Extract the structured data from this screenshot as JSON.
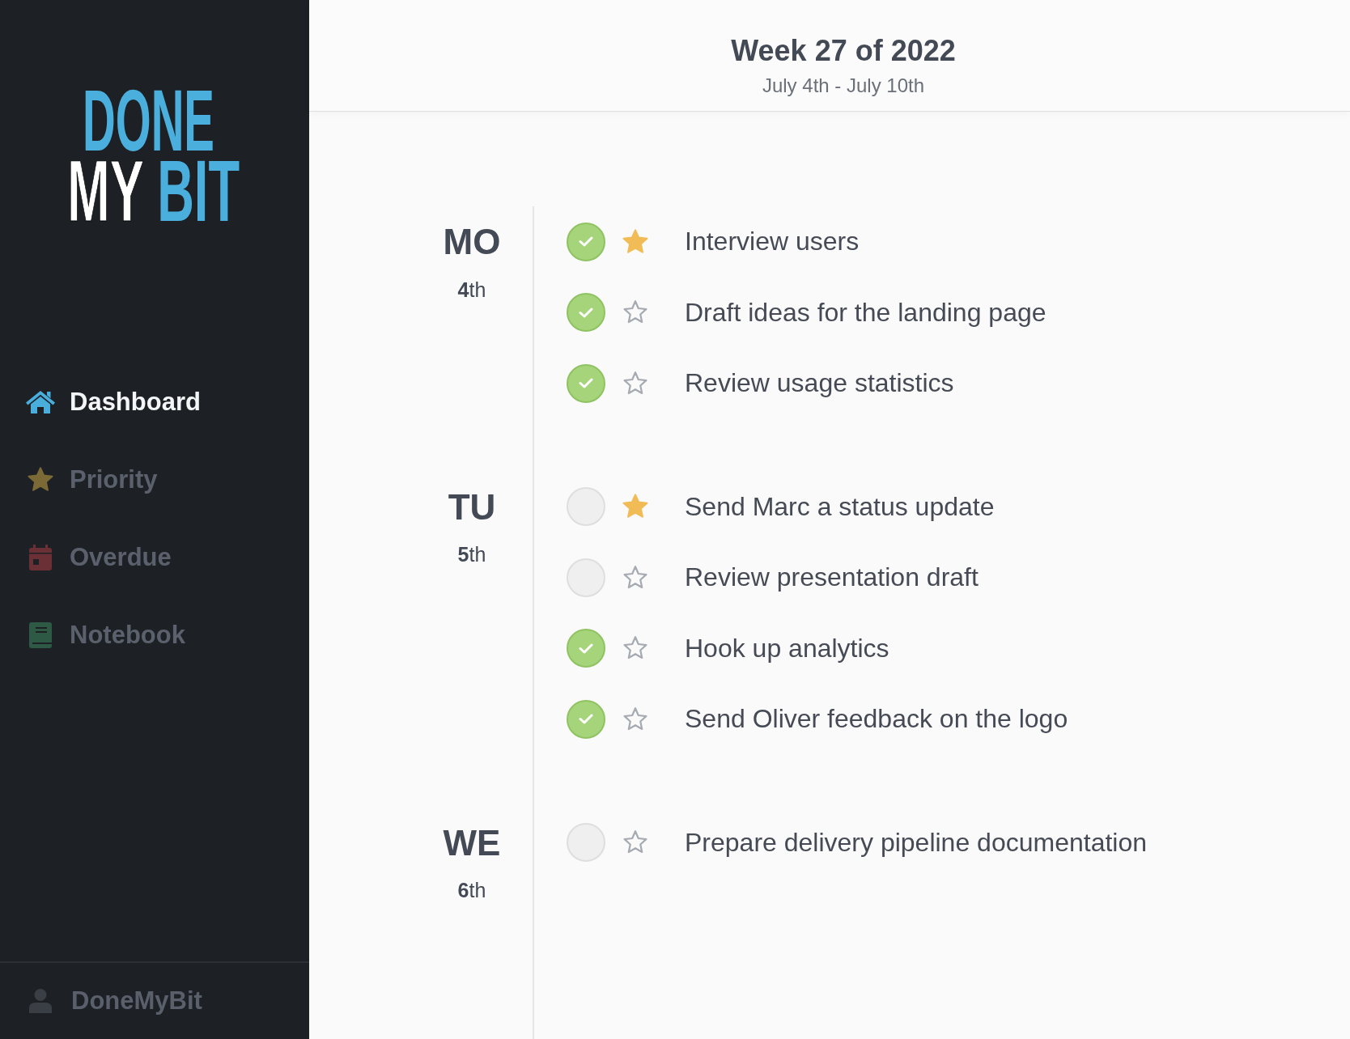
{
  "sidebar": {
    "logo": {
      "top": "DONE",
      "bottom_left": "MY",
      "bottom_right": "BIT"
    },
    "nav": [
      {
        "label": "Dashboard",
        "kind": "home",
        "color": "#4aaedc",
        "selected": true
      },
      {
        "label": "Priority",
        "kind": "star",
        "color": "#7b6a36",
        "selected": false
      },
      {
        "label": "Overdue",
        "kind": "calendar",
        "color": "#6b3035",
        "selected": false
      },
      {
        "label": "Notebook",
        "kind": "book",
        "color": "#2e5a45",
        "selected": false
      }
    ],
    "account": {
      "name": "DoneMyBit"
    }
  },
  "header": {
    "title": "Week 27 of 2022",
    "subtitle": "July 4th - July 10th"
  },
  "days": [
    {
      "name": "MO",
      "date": "**4**th",
      "tasks": [
        {
          "title": "Interview users",
          "done": true,
          "starred": true
        },
        {
          "title": "Draft ideas for the landing page",
          "done": true,
          "starred": false
        },
        {
          "title": "Review usage statistics",
          "done": true,
          "starred": false
        }
      ]
    },
    {
      "name": "TU",
      "date": "**5**th",
      "tasks": [
        {
          "title": "Send Marc a status update",
          "done": false,
          "starred": true
        },
        {
          "title": "Review presentation draft",
          "done": false,
          "starred": false
        },
        {
          "title": "Hook up analytics",
          "done": true,
          "starred": false
        },
        {
          "title": "Send Oliver feedback on the logo",
          "done": true,
          "starred": false
        }
      ]
    },
    {
      "name": "WE",
      "date": "**6**th",
      "tasks": [
        {
          "title": "Prepare delivery pipeline documentation",
          "done": false,
          "starred": false
        }
      ]
    }
  ]
}
